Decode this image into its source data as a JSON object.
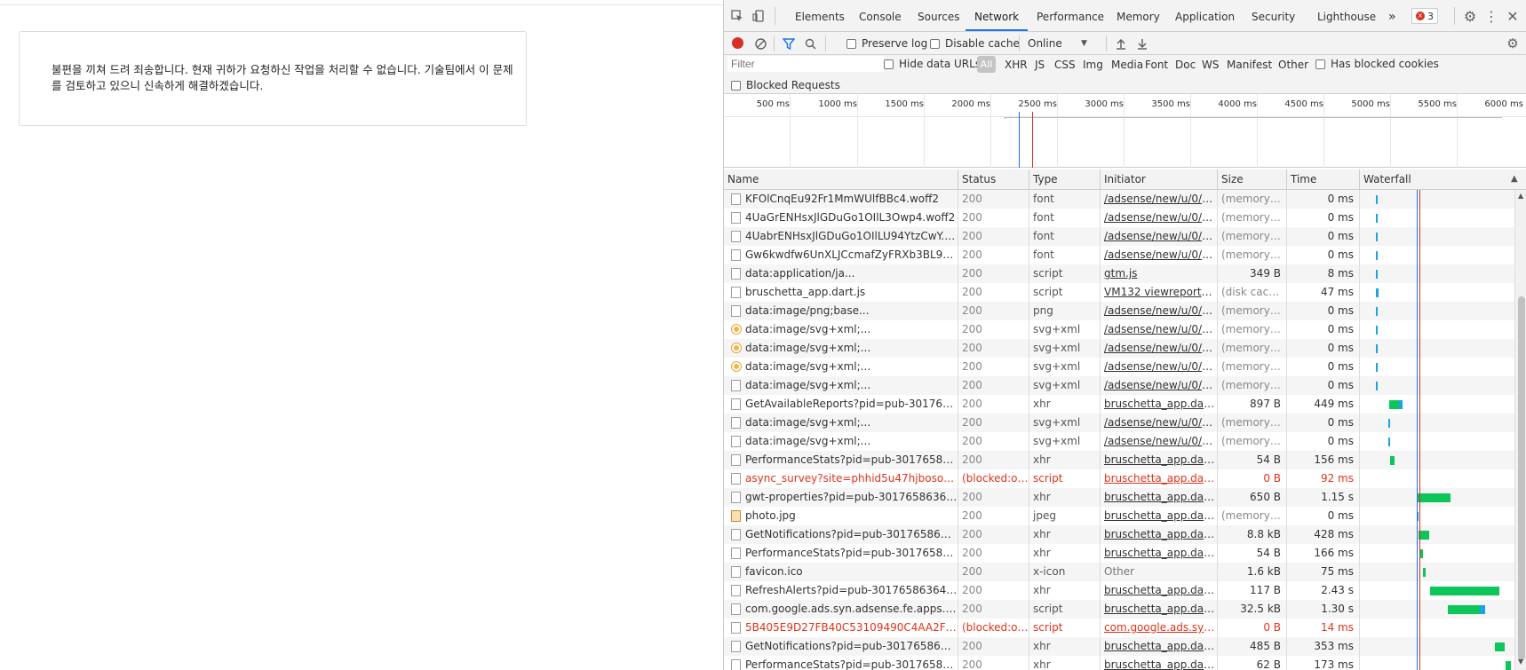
{
  "page": {
    "error_message": "불편을 끼쳐 드려 죄송합니다. 현재 귀하가 요청하신 작업을 처리할 수 없습니다. 기술팀에서 이 문제를 검토하고 있으니 신속하게 해결하겠습니다."
  },
  "devtools": {
    "tabs": [
      "Elements",
      "Console",
      "Sources",
      "Network",
      "Performance",
      "Memory",
      "Application",
      "Security",
      "Lighthouse"
    ],
    "active_tab": "Network",
    "more_tabs": "»",
    "error_count": "3",
    "toolbar": {
      "preserve_log": "Preserve log",
      "disable_cache": "Disable cache",
      "throttle": "Online"
    },
    "filter": {
      "placeholder": "Filter",
      "hide_data_urls": "Hide data URLs",
      "all": "All",
      "types": [
        "XHR",
        "JS",
        "CSS",
        "Img",
        "Media",
        "Font",
        "Doc",
        "WS",
        "Manifest",
        "Other"
      ],
      "has_blocked_cookies": "Has blocked cookies",
      "blocked_requests": "Blocked Requests"
    },
    "timeline_labels": [
      "500 ms",
      "1000 ms",
      "1500 ms",
      "2000 ms",
      "2500 ms",
      "3000 ms",
      "3500 ms",
      "4000 ms",
      "4500 ms",
      "5000 ms",
      "5500 ms",
      "6000 ms"
    ],
    "columns": {
      "name": "Name",
      "status": "Status",
      "type": "Type",
      "initiator": "Initiator",
      "size": "Size",
      "time": "Time",
      "waterfall": "Waterfall"
    },
    "rows": [
      {
        "name": "KFOlCnqEu92Fr1MmWUlfBBc4.woff2",
        "status": "200",
        "type": "font",
        "initiator": "/adsense/new/u/0/p...",
        "size": "(memory c...",
        "time": "0 ms",
        "icon": "file"
      },
      {
        "name": "4UaGrENHsxJlGDuGo1OIlL3Owp4.woff2",
        "status": "200",
        "type": "font",
        "initiator": "/adsense/new/u/0/p...",
        "size": "(memory c...",
        "time": "0 ms",
        "icon": "file"
      },
      {
        "name": "4UabrENHsxJlGDuGo1OIlLU94YtzCwY.woff2",
        "status": "200",
        "type": "font",
        "initiator": "/adsense/new/u/0/p...",
        "size": "(memory c...",
        "time": "0 ms",
        "icon": "file"
      },
      {
        "name": "Gw6kwdfw6UnXLJCcmafZyFRXb3BL9rvi0Q...",
        "status": "200",
        "type": "font",
        "initiator": "/adsense/new/u/0/p...",
        "size": "(memory c...",
        "time": "0 ms",
        "icon": "file"
      },
      {
        "name": "data:application/ja...",
        "status": "200",
        "type": "script",
        "initiator": "gtm.js",
        "size": "349 B",
        "time": "8 ms",
        "icon": "file"
      },
      {
        "name": "bruschetta_app.dart.js",
        "status": "200",
        "type": "script",
        "initiator": "VM132 viewreports:44",
        "size": "(disk cache)",
        "time": "47 ms",
        "icon": "file"
      },
      {
        "name": "data:image/png;base...",
        "status": "200",
        "type": "png",
        "initiator": "/adsense/new/u/0/p...",
        "size": "(memory c...",
        "time": "0 ms",
        "icon": "file"
      },
      {
        "name": "data:image/svg+xml;...",
        "status": "200",
        "type": "svg+xml",
        "initiator": "/adsense/new/u/0/p...",
        "size": "(memory c...",
        "time": "0 ms",
        "icon": "svg"
      },
      {
        "name": "data:image/svg+xml;...",
        "status": "200",
        "type": "svg+xml",
        "initiator": "/adsense/new/u/0/p...",
        "size": "(memory c...",
        "time": "0 ms",
        "icon": "svg"
      },
      {
        "name": "data:image/svg+xml;...",
        "status": "200",
        "type": "svg+xml",
        "initiator": "/adsense/new/u/0/p...",
        "size": "(memory c...",
        "time": "0 ms",
        "icon": "svg"
      },
      {
        "name": "data:image/svg+xml;...",
        "status": "200",
        "type": "svg+xml",
        "initiator": "/adsense/new/u/0/p...",
        "size": "(memory c...",
        "time": "0 ms",
        "icon": "file"
      },
      {
        "name": "GetAvailableReports?pid=pub-301765863...",
        "status": "200",
        "type": "xhr",
        "initiator": "bruschetta_app.dart.j...",
        "size": "897 B",
        "time": "449 ms",
        "icon": "file"
      },
      {
        "name": "data:image/svg+xml;...",
        "status": "200",
        "type": "svg+xml",
        "initiator": "/adsense/new/u/0/p...",
        "size": "(memory c...",
        "time": "0 ms",
        "icon": "file"
      },
      {
        "name": "data:image/svg+xml;...",
        "status": "200",
        "type": "svg+xml",
        "initiator": "/adsense/new/u/0/p...",
        "size": "(memory c...",
        "time": "0 ms",
        "icon": "file"
      },
      {
        "name": "PerformanceStats?pid=pub-30176586364...",
        "status": "200",
        "type": "xhr",
        "initiator": "bruschetta_app.dart.j...",
        "size": "54 B",
        "time": "156 ms",
        "icon": "file"
      },
      {
        "name": "async_survey?site=phhid5u47hjbosokitevo...",
        "status": "(blocked:ot...",
        "type": "script",
        "initiator": "bruschetta_app.dart.j...",
        "size": "0 B",
        "time": "92 ms",
        "icon": "file",
        "error": true
      },
      {
        "name": "gwt-properties?pid=pub-30176586364487...",
        "status": "200",
        "type": "xhr",
        "initiator": "bruschetta_app.dart.j...",
        "size": "650 B",
        "time": "1.15 s",
        "icon": "file"
      },
      {
        "name": "photo.jpg",
        "status": "200",
        "type": "jpeg",
        "initiator": "bruschetta_app.dart.j...",
        "size": "(memory c...",
        "time": "0 ms",
        "icon": "img"
      },
      {
        "name": "GetNotifications?pid=pub-301765863648...",
        "status": "200",
        "type": "xhr",
        "initiator": "bruschetta_app.dart.j...",
        "size": "8.8 kB",
        "time": "428 ms",
        "icon": "file"
      },
      {
        "name": "PerformanceStats?pid=pub-30176586364...",
        "status": "200",
        "type": "xhr",
        "initiator": "bruschetta_app.dart.j...",
        "size": "54 B",
        "time": "166 ms",
        "icon": "file"
      },
      {
        "name": "favicon.ico",
        "status": "200",
        "type": "x-icon",
        "initiator": "Other",
        "size": "1.6 kB",
        "time": "75 ms",
        "icon": "file",
        "plain_initiator": true
      },
      {
        "name": "RefreshAlerts?pid=pub-301765863648706...",
        "status": "200",
        "type": "xhr",
        "initiator": "bruschetta_app.dart.j...",
        "size": "117 B",
        "time": "2.43 s",
        "icon": "file"
      },
      {
        "name": "com.google.ads.syn.adsense.fe.apps.main....",
        "status": "200",
        "type": "script",
        "initiator": "bruschetta_app.dart.j...",
        "size": "32.5 kB",
        "time": "1.30 s",
        "icon": "file"
      },
      {
        "name": "5B405E9D27FB40C53109490C4AA2FB71.c...",
        "status": "(blocked:ot...",
        "type": "script",
        "initiator": "com.google.ads.syn....",
        "size": "0 B",
        "time": "14 ms",
        "icon": "file",
        "error": true
      },
      {
        "name": "GetNotifications?pid=pub-301765863648...",
        "status": "200",
        "type": "xhr",
        "initiator": "bruschetta_app.dart.j...",
        "size": "485 B",
        "time": "353 ms",
        "icon": "file"
      },
      {
        "name": "PerformanceStats?pid=pub-30176586364...",
        "status": "200",
        "type": "xhr",
        "initiator": "bruschetta_app.dart.j...",
        "size": "62 B",
        "time": "173 ms",
        "icon": "file"
      }
    ],
    "colors": {
      "accent": "#1a73e8",
      "error_text": "#e0331b",
      "waterfall_green": "#0cc65a",
      "waterfall_blue": "#1aa3e8",
      "dom_line": "#1a73e8",
      "load_line": "#d93025"
    }
  }
}
